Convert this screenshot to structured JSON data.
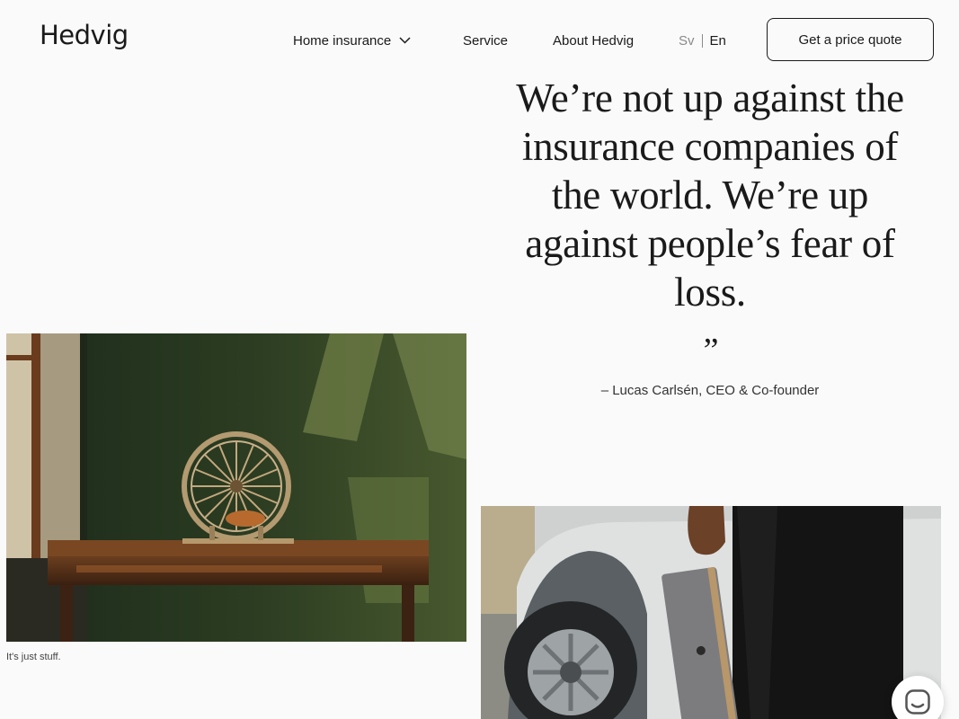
{
  "header": {
    "logo": "Hedvig",
    "nav": {
      "home_insurance": "Home insurance",
      "service": "Service",
      "about": "About Hedvig"
    },
    "lang": {
      "sv": "Sv",
      "en": "En"
    },
    "cta": "Get a price quote"
  },
  "hero": {
    "quote": "We’re not up against the insurance companies of the world. We’re up against people’s fear of loss.",
    "quote_mark": "”",
    "attribution": "– Lucas Carlsén, CEO & Co-founder"
  },
  "media": {
    "left_caption": "It's just stuff."
  },
  "icons": {
    "nav_dropdown": "chevron-down-icon",
    "chat": "chat-icon"
  },
  "colors": {
    "background": "#fafafa",
    "text": "#1a1a1a",
    "muted": "#8a8a8a"
  }
}
